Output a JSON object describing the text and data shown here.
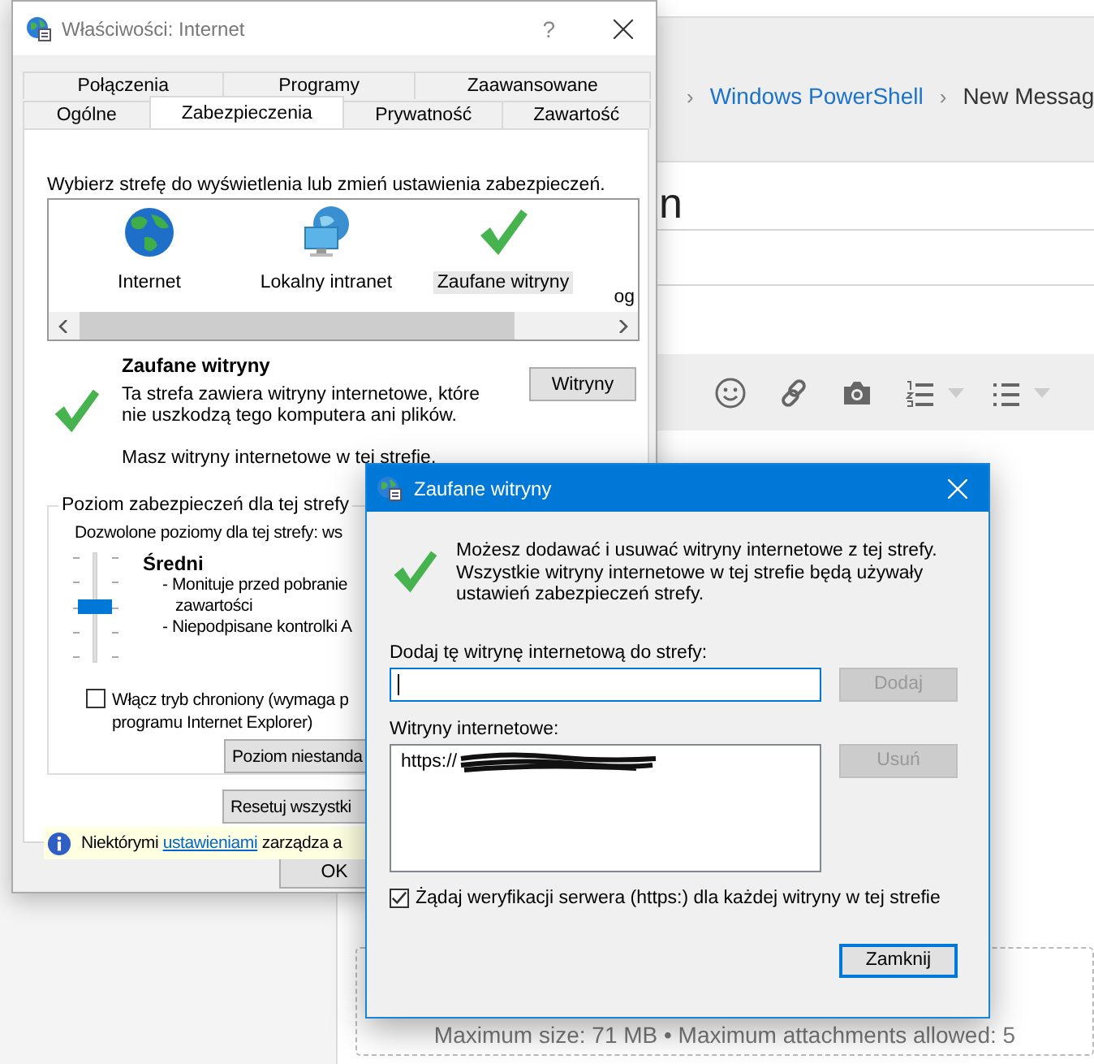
{
  "background_page": {
    "breadcrumb": [
      {
        "text": "›",
        "kind": "separator"
      },
      {
        "text": "Windows PowerShell",
        "kind": "link"
      },
      {
        "text": "›",
        "kind": "separator"
      },
      {
        "text": "New Messag",
        "kind": "current"
      }
    ],
    "heading": "n",
    "toolbar": [
      {
        "kind": "smiley",
        "dropdown": false
      },
      {
        "kind": "link",
        "dropdown": false
      },
      {
        "kind": "camera",
        "dropdown": false
      },
      {
        "kind": "numbered-list",
        "dropdown": true
      },
      {
        "kind": "bullet-list",
        "dropdown": true
      }
    ],
    "attachments_note": "Maximum size: 71 MB • Maximum attachments allowed: 5"
  },
  "internet_options": {
    "title": "Właściwości: Internet",
    "help_button": "?",
    "tab_rows": [
      [
        {
          "label": "Połączenia",
          "selected": false
        },
        {
          "label": "Programy",
          "selected": false
        },
        {
          "label": "Zaawansowane",
          "selected": false
        }
      ],
      [
        {
          "label": "Ogólne",
          "selected": false
        },
        {
          "label": "Zabezpieczenia",
          "selected": true
        },
        {
          "label": "Prywatność",
          "selected": false
        },
        {
          "label": "Zawartość",
          "selected": false
        }
      ]
    ],
    "zone_prompt": "Wybierz strefę do wyświetlenia lub zmień ustawienia zabezpieczeń.",
    "zones": [
      {
        "label": "Internet",
        "kind": "globe",
        "selected": false
      },
      {
        "label": "Lokalny intranet",
        "kind": "intranet",
        "selected": false
      },
      {
        "label": "Zaufane witryny",
        "kind": "trusted",
        "selected": true
      }
    ],
    "zones_overflow": "og",
    "zone_name": "Zaufane witryny",
    "zone_description": "Ta strefa zawiera witryny internetowe, które nie uszkodzą tego komputera ani plików.",
    "zone_note": "Masz witryny internetowe w tej strefie.",
    "sites_button": "Witryny",
    "security_level": {
      "legend": "Poziom zabezpieczeń dla tej strefy",
      "allowed": "Dozwolone poziomy dla tej strefy: ws",
      "level": 0.5,
      "name": "Średni",
      "lines": [
        "- Monituje przed pobranie",
        "zawartości",
        "- Niepodpisane kontrolki A"
      ],
      "protected_mode": {
        "lines": [
          "Włącz tryb chroniony (wymaga p",
          "programu Internet Explorer)"
        ],
        "checked": false
      },
      "custom_button": "Poziom niestanda"
    },
    "reset_button": "Resetuj wszystki",
    "info_bar": {
      "before": "Niektórymi ",
      "link": "ustawieniami",
      "after": " zarządza a"
    },
    "ok_button": "OK"
  },
  "trusted_sites": {
    "title": "Zaufane witryny",
    "description": "Możesz dodawać i usuwać witryny internetowe z tej strefy. Wszystkie witryny internetowe w tej strefie będą używały ustawień zabezpieczeń strefy.",
    "add_label": "Dodaj tę witrynę internetową do strefy:",
    "add_field": {
      "focused": true
    },
    "add_button": {
      "label": "Dodaj",
      "disabled": true
    },
    "sites_label": "Witryny internetowe:",
    "sites": [
      {
        "text": "https://",
        "redacted": true
      }
    ],
    "remove_button": {
      "label": "Usuń",
      "disabled": true
    },
    "require_https": {
      "label": "Żądaj weryfikacji serwera (https:) dla każdej witryny w tej strefie",
      "checked": true
    },
    "close_button": "Zamknij"
  }
}
